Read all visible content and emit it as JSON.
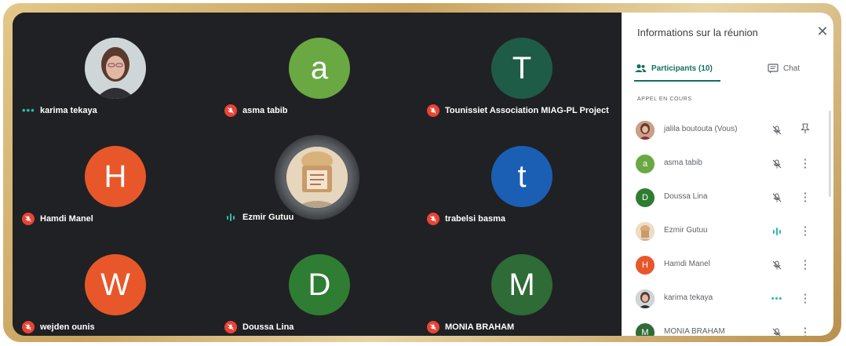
{
  "colors": {
    "frame_gold": "#d2b06c",
    "grid_bg": "#202124",
    "accent_teal": "#12715f",
    "mic_off_red": "#ea4335",
    "speaking_green": "#2bbfa4"
  },
  "grid": {
    "tiles": [
      {
        "name": "karima tekaya",
        "avatar": "photo",
        "status": "speaking-dots",
        "status_icon": "dots-icon"
      },
      {
        "name": "asma tabib",
        "avatar_letter": "a",
        "avatar_color": "#6aa843",
        "status": "muted",
        "status_icon": "mic-off-icon"
      },
      {
        "name": "Tounissiet Association MIAG-PL Project",
        "avatar_letter": "T",
        "avatar_color": "#1e5c47",
        "status": "muted",
        "status_icon": "mic-off-icon"
      },
      {
        "name": "Hamdi Manel",
        "avatar_letter": "H",
        "avatar_color": "#e8572a",
        "status": "muted",
        "status_icon": "mic-off-icon"
      },
      {
        "name": "Ezmir Gutuu",
        "avatar": "photo",
        "status": "speaking-wave",
        "status_icon": "audio-wave-icon"
      },
      {
        "name": "trabelsi basma",
        "avatar_letter": "t",
        "avatar_color": "#1a5fb4",
        "status": "muted",
        "status_icon": "mic-off-icon"
      },
      {
        "name": "wejden ounis",
        "avatar_letter": "W",
        "avatar_color": "#e8572a",
        "status": "muted",
        "status_icon": "mic-off-icon"
      },
      {
        "name": "Doussa Lina",
        "avatar_letter": "D",
        "avatar_color": "#2e7d32",
        "status": "muted",
        "status_icon": "mic-off-icon"
      },
      {
        "name": "MONIA BRAHAM",
        "avatar_letter": "M",
        "avatar_color": "#2e6b36",
        "status": "muted",
        "status_icon": "mic-off-icon"
      }
    ]
  },
  "panel": {
    "title": "Informations sur la réunion",
    "close_icon": "close-icon",
    "tabs": [
      {
        "label": "Participants (10)",
        "icon": "people-icon",
        "active": true
      },
      {
        "label": "Chat",
        "icon": "chat-icon",
        "active": false
      }
    ],
    "section_label": "APPEL EN COURS",
    "participants": [
      {
        "name": "jalila boutouta (Vous)",
        "avatar": "photo",
        "mic": "muted",
        "action_icon": "pin-icon"
      },
      {
        "name": "asma tabib",
        "avatar_letter": "a",
        "avatar_color": "#6aa843",
        "mic": "muted",
        "action_icon": "more-vert-icon"
      },
      {
        "name": "Doussa Lina",
        "avatar_letter": "D",
        "avatar_color": "#2e7d32",
        "mic": "muted",
        "action_icon": "more-vert-icon"
      },
      {
        "name": "Ezmir Gutuu",
        "avatar": "photo",
        "mic": "speaking-wave",
        "action_icon": "more-vert-icon"
      },
      {
        "name": "Hamdi Manel",
        "avatar_letter": "H",
        "avatar_color": "#e8572a",
        "mic": "muted",
        "action_icon": "more-vert-icon"
      },
      {
        "name": "karima tekaya",
        "avatar": "photo",
        "mic": "speaking-dots",
        "action_icon": "more-vert-icon"
      },
      {
        "name": "MONIA BRAHAM",
        "avatar_letter": "M",
        "avatar_color": "#2e6b36",
        "mic": "muted",
        "action_icon": "more-vert-icon"
      }
    ]
  }
}
